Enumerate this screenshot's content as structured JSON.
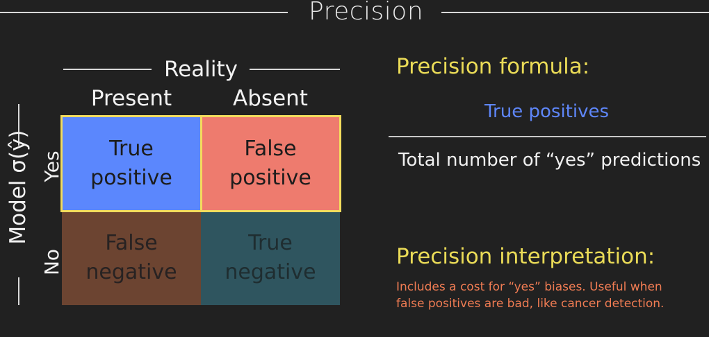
{
  "title": "Precision",
  "matrix": {
    "column_header": "Reality",
    "columns": [
      "Present",
      "Absent"
    ],
    "row_header": "Model σ(ŷ)",
    "rows": [
      "Yes",
      "No"
    ],
    "cells": {
      "true_positive": [
        "True",
        "positive"
      ],
      "false_positive": [
        "False",
        "positive"
      ],
      "false_negative": [
        "False",
        "negative"
      ],
      "true_negative": [
        "True",
        "negative"
      ]
    }
  },
  "formula": {
    "heading": "Precision formula:",
    "numerator": "True positives",
    "denominator": "Total number of “yes” predictions"
  },
  "interpretation": {
    "heading": "Precision interpretation:",
    "lines": [
      "Includes a cost for “yes” biases. Useful when",
      "false positives are bad, like cancer detection."
    ]
  },
  "colors": {
    "true_positive": "#5b87fd",
    "false_positive": "#ee7b6e",
    "false_negative": "#6c4431",
    "true_negative": "#2f555f",
    "highlight_border": "#f2dc5d",
    "heading_yellow": "#eadb57",
    "numerator_blue": "#5e86f9",
    "body_orange": "#f07c53"
  }
}
